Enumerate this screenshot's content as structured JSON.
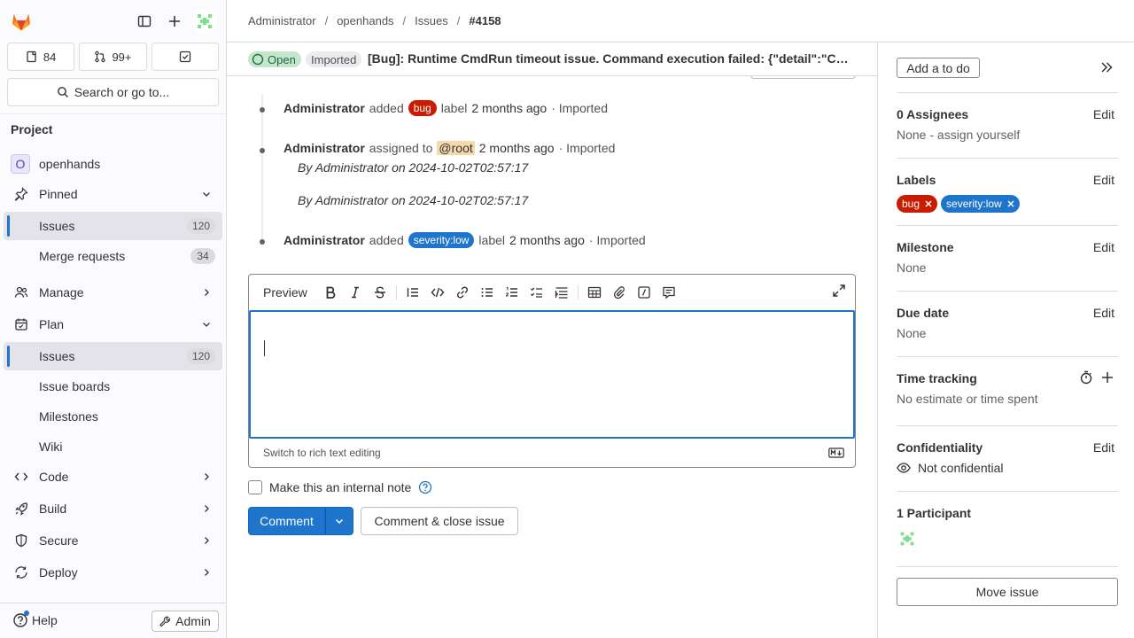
{
  "sidebar": {
    "issues_count": "84",
    "mr_count": "99+",
    "search_label": "Search or go to...",
    "section_heading": "Project",
    "project_name": "openhands",
    "project_initial": "O",
    "pinned_label": "Pinned",
    "pinned_items": [
      {
        "label": "Issues",
        "count": "120"
      },
      {
        "label": "Merge requests",
        "count": "34"
      }
    ],
    "manage_label": "Manage",
    "plan_label": "Plan",
    "plan_items": [
      {
        "label": "Issues",
        "count": "120"
      },
      {
        "label": "Issue boards"
      },
      {
        "label": "Milestones"
      },
      {
        "label": "Wiki"
      }
    ],
    "code_label": "Code",
    "build_label": "Build",
    "secure_label": "Secure",
    "deploy_label": "Deploy",
    "help_label": "Help",
    "admin_label": "Admin"
  },
  "breadcrumb": [
    "Administrator",
    "openhands",
    "Issues",
    "#4158"
  ],
  "issue": {
    "status": "Open",
    "imported_badge": "Imported",
    "title": "[Bug]: Runtime CmdRun timeout issue. Command execution failed: {\"detail\":\"Command timed out\"}"
  },
  "timeline": [
    {
      "author": "Administrator",
      "action": "added",
      "label": "bug",
      "suffix": "label",
      "time": "2 months ago",
      "source": "· Imported"
    },
    {
      "author": "Administrator",
      "action": "assigned to",
      "mention": "@root",
      "time": "2 months ago",
      "source": "· Imported",
      "notes": [
        "By Administrator on 2024-10-02T02:57:17",
        "By Administrator on 2024-10-02T02:57:17"
      ]
    },
    {
      "author": "Administrator",
      "action": "added",
      "label": "severity:low",
      "suffix": "label",
      "time": "2 months ago",
      "source": "· Imported"
    }
  ],
  "editor": {
    "preview_label": "Preview",
    "footer_text": "Switch to rich text editing",
    "internal_note_label": "Make this an internal note",
    "comment_button": "Comment",
    "close_button": "Comment & close issue"
  },
  "right_sidebar": {
    "todo_button": "Add a to do",
    "edit_label": "Edit",
    "assignees_title": "0 Assignees",
    "assignees_value": "None - assign yourself",
    "labels_title": "Labels",
    "labels": [
      "bug",
      "severity:low"
    ],
    "milestone_title": "Milestone",
    "milestone_value": "None",
    "due_title": "Due date",
    "due_value": "None",
    "time_title": "Time tracking",
    "time_value": "No estimate or time spent",
    "conf_title": "Confidentiality",
    "conf_value": "Not confidential",
    "participants_title": "1 Participant",
    "move_button": "Move issue"
  },
  "colors": {
    "accent": "#1f75cb",
    "bug_label": "#c91c00",
    "open_badge_bg": "#c3e6cd"
  }
}
